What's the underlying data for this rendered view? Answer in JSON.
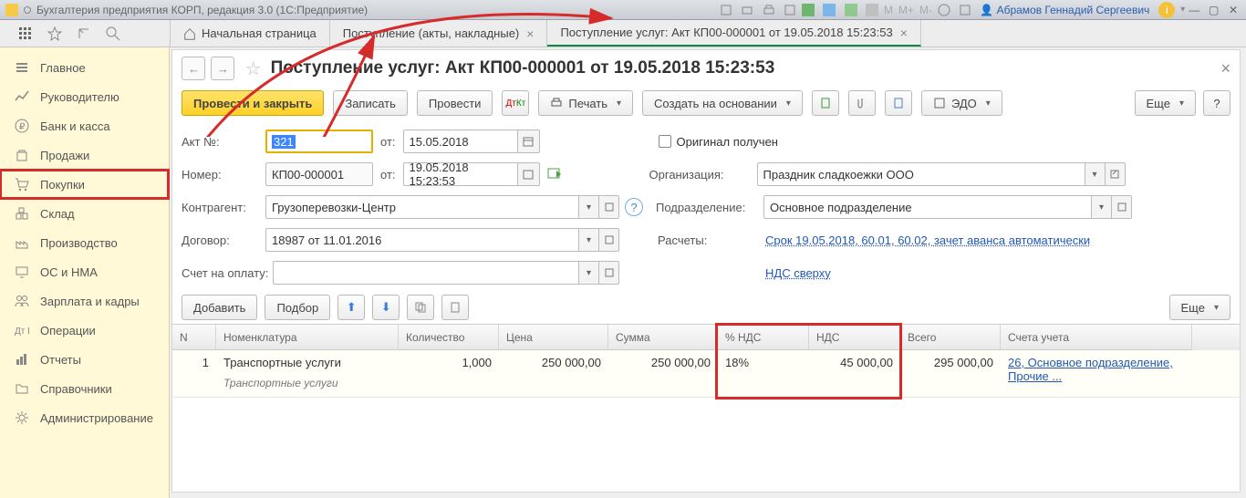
{
  "window": {
    "app_title": "Бухгалтерия предприятия КОРП, редакция 3.0  (1С:Предприятие)",
    "user": "Абрамов Геннадий Сергеевич"
  },
  "tabs": {
    "start": "Начальная страница",
    "t1": "Поступление (акты, накладные)",
    "t2": "Поступление услуг: Акт КП00-000001 от 19.05.2018 15:23:53"
  },
  "sidebar": {
    "main": "Главное",
    "manager": "Руководителю",
    "bank": "Банк и касса",
    "sales": "Продажи",
    "purchases": "Покупки",
    "stock": "Склад",
    "production": "Производство",
    "os": "ОС и НМА",
    "salary": "Зарплата и кадры",
    "operations": "Операции",
    "reports": "Отчеты",
    "refs": "Справочники",
    "admin": "Администрирование"
  },
  "page": {
    "title": "Поступление услуг: Акт КП00-000001 от 19.05.2018 15:23:53",
    "btn_post_close": "Провести и закрыть",
    "btn_write": "Записать",
    "btn_post": "Провести",
    "btn_print": "Печать",
    "btn_create_based": "Создать на основании",
    "btn_edo": "ЭДО",
    "btn_more": "Еще",
    "btn_q": "?"
  },
  "form": {
    "akt_lbl": "Акт №:",
    "akt_no": "321",
    "akt_from": "от:",
    "akt_date": "15.05.2018",
    "orig_received": "Оригинал получен",
    "num_lbl": "Номер:",
    "num": "КП00-000001",
    "num_from": "от:",
    "num_date": "19.05.2018 15:23:53",
    "org_lbl": "Организация:",
    "org": "Праздник сладкоежки ООО",
    "partner_lbl": "Контрагент:",
    "partner": "Грузоперевозки-Центр",
    "dept_lbl": "Подразделение:",
    "dept": "Основное подразделение",
    "contract_lbl": "Договор:",
    "contract": "18987 от 11.01.2016",
    "calc_lbl": "Расчеты:",
    "calc_link": "Срок 19.05.2018, 60.01, 60.02, зачет аванса автоматически",
    "invoice_lbl": "Счет на оплату:",
    "vat_link": "НДС сверху"
  },
  "tabtool": {
    "add": "Добавить",
    "pick": "Подбор",
    "more": "Еще"
  },
  "grid": {
    "headers": {
      "n": "N",
      "nom": "Номенклатура",
      "qty": "Количество",
      "price": "Цена",
      "sum": "Сумма",
      "vatpct": "% НДС",
      "vat": "НДС",
      "total": "Всего",
      "acc": "Счета учета"
    },
    "row": {
      "n": "1",
      "nom": "Транспортные услуги",
      "nom_sub": "Транспортные услуги",
      "qty": "1,000",
      "price": "250 000,00",
      "sum": "250 000,00",
      "vatpct": "18%",
      "vat": "45 000,00",
      "total": "295 000,00",
      "acc": "26, Основное подразделение, Прочие ..."
    }
  }
}
